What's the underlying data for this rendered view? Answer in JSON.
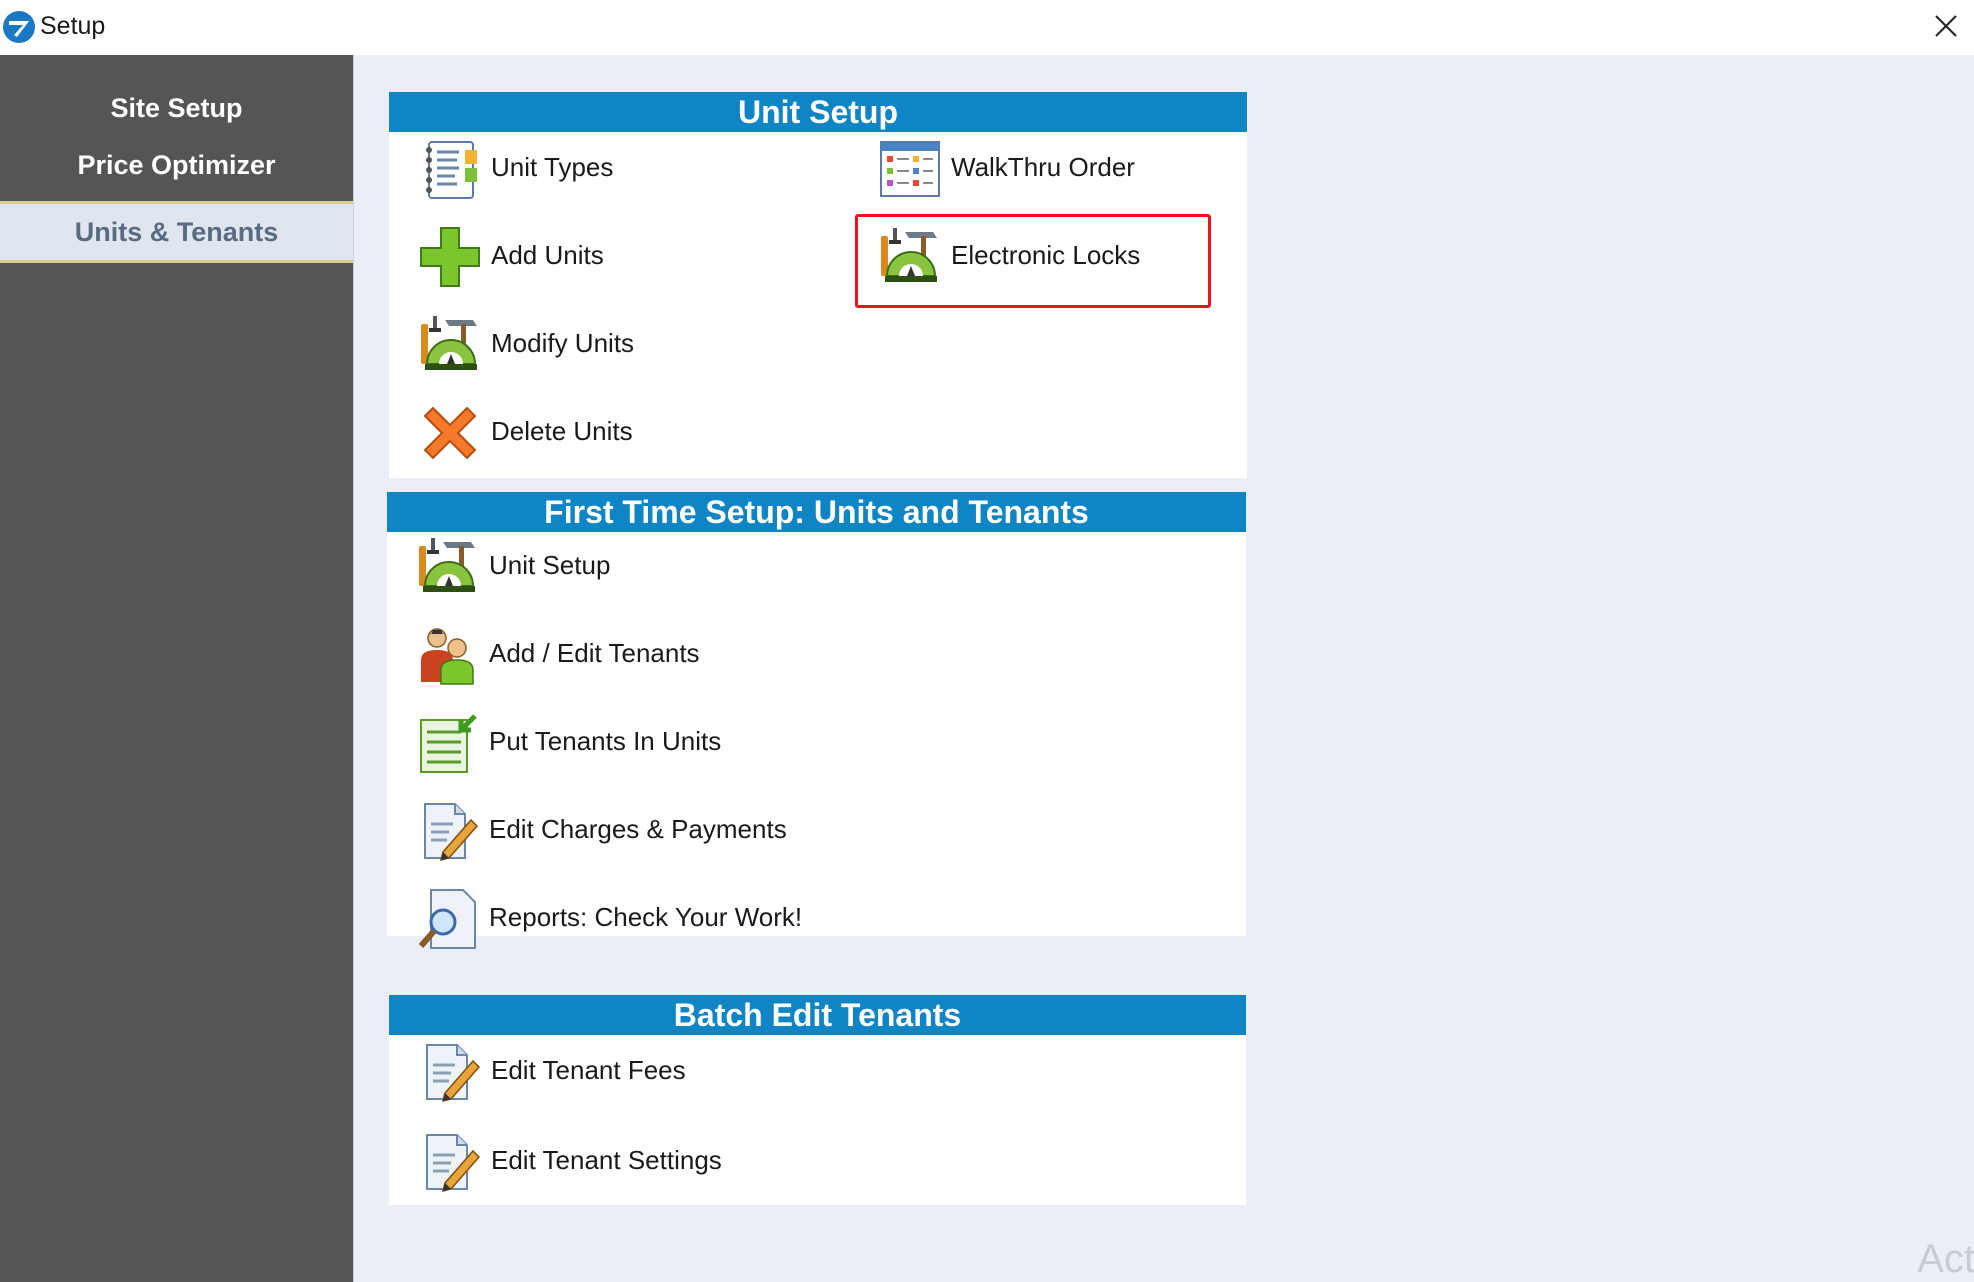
{
  "window": {
    "title": "Setup"
  },
  "sidebar": {
    "items": [
      {
        "label": "Site Setup"
      },
      {
        "label": "Price Optimizer"
      },
      {
        "label": "Units & Tenants"
      }
    ]
  },
  "sections": {
    "unit_setup": {
      "header": "Unit Setup",
      "items": [
        {
          "label": "Unit Types",
          "icon": "notebook-icon"
        },
        {
          "label": "WalkThru Order",
          "icon": "list-window-icon"
        },
        {
          "label": "Add Units",
          "icon": "plus-icon"
        },
        {
          "label": "Electronic Locks",
          "icon": "tools-protractor-icon"
        },
        {
          "label": "Modify Units",
          "icon": "tools-protractor-icon"
        },
        {
          "label": "Delete Units",
          "icon": "delete-x-icon"
        }
      ]
    },
    "first_time_setup": {
      "header": "First Time Setup:  Units and Tenants",
      "items": [
        {
          "label": "Unit Setup",
          "icon": "tools-protractor-icon"
        },
        {
          "label": "Add / Edit Tenants",
          "icon": "people-icon"
        },
        {
          "label": "Put Tenants In Units",
          "icon": "sheet-arrow-icon"
        },
        {
          "label": "Edit Charges & Payments",
          "icon": "document-pencil-icon"
        },
        {
          "label": "Reports:   Check Your Work!",
          "icon": "document-magnifier-icon"
        }
      ]
    },
    "batch_edit": {
      "header": "Batch Edit Tenants",
      "items": [
        {
          "label": "Edit Tenant Fees",
          "icon": "document-pencil-icon"
        },
        {
          "label": "Edit Tenant Settings",
          "icon": "document-pencil-icon"
        }
      ]
    }
  },
  "colors": {
    "sidebar_bg": "#555555",
    "header_blue": "#0f85c6",
    "highlight_red": "#e8141c"
  },
  "watermark": "Act"
}
